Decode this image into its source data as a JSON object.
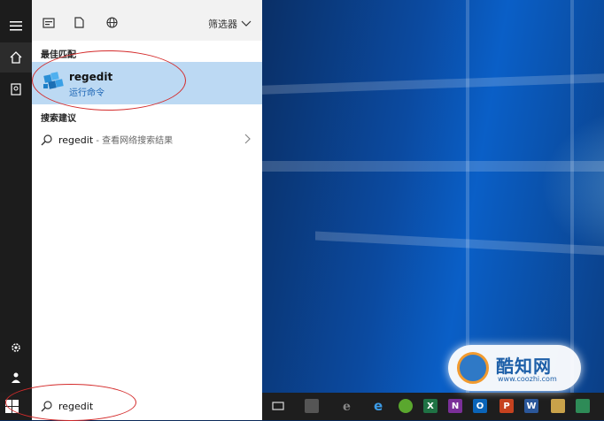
{
  "panel": {
    "filter_label": "筛选器",
    "best_match_label": "最佳匹配",
    "best_match": {
      "title": "regedit",
      "subtitle": "运行命令"
    },
    "suggestion_label": "搜索建议",
    "suggestion": {
      "term": "regedit",
      "hint": " - 查看网络搜索结果"
    }
  },
  "search": {
    "value": "regedit"
  },
  "watermark": {
    "name": "酷知网",
    "url": "www.coozhi.com"
  },
  "taskbar_apps": [
    {
      "name": "Excel",
      "glyph": "X",
      "color": "#1f7244"
    },
    {
      "name": "OneNote",
      "glyph": "N",
      "color": "#7a2f98"
    },
    {
      "name": "Outlook",
      "glyph": "O",
      "color": "#0a64b8"
    },
    {
      "name": "PowerPoint",
      "glyph": "P",
      "color": "#c6421f"
    },
    {
      "name": "Word",
      "glyph": "W",
      "color": "#2b579a"
    }
  ]
}
